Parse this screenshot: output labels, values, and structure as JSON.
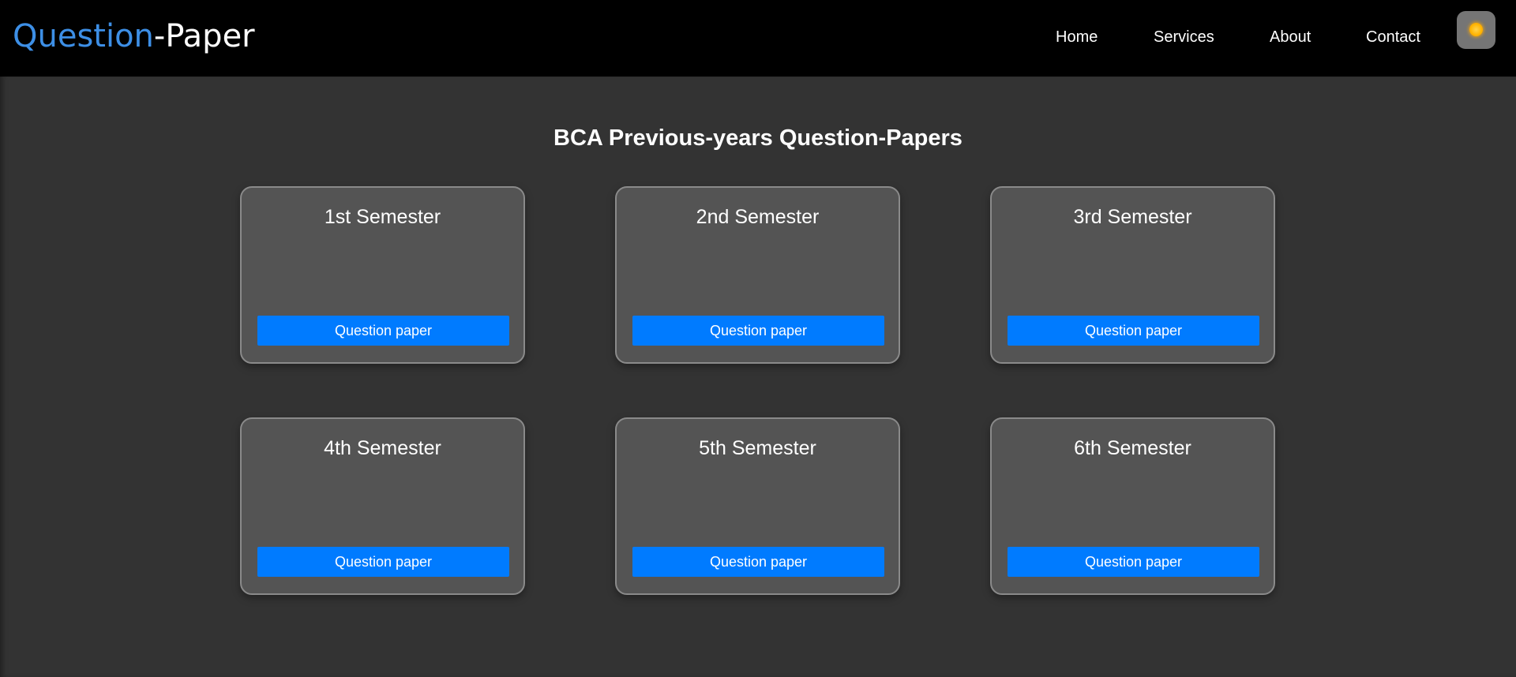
{
  "header": {
    "logo_part1": "Question",
    "logo_part2": "-Paper",
    "nav": [
      "Home",
      "Services",
      "About",
      "Contact"
    ],
    "theme_toggle_icon": "sun-icon"
  },
  "main": {
    "title": "BCA Previous-years Question-Papers",
    "cards": [
      {
        "title": "1st Semester",
        "button": "Question paper"
      },
      {
        "title": "2nd Semester",
        "button": "Question paper"
      },
      {
        "title": "3rd Semester",
        "button": "Question paper"
      },
      {
        "title": "4th Semester",
        "button": "Question paper"
      },
      {
        "title": "5th Semester",
        "button": "Question paper"
      },
      {
        "title": "6th Semester",
        "button": "Question paper"
      }
    ]
  },
  "colors": {
    "header_bg": "#000000",
    "page_bg": "#333333",
    "card_bg": "#545454",
    "button_bg": "#007bff",
    "logo_accent": "#3d8fe6"
  }
}
